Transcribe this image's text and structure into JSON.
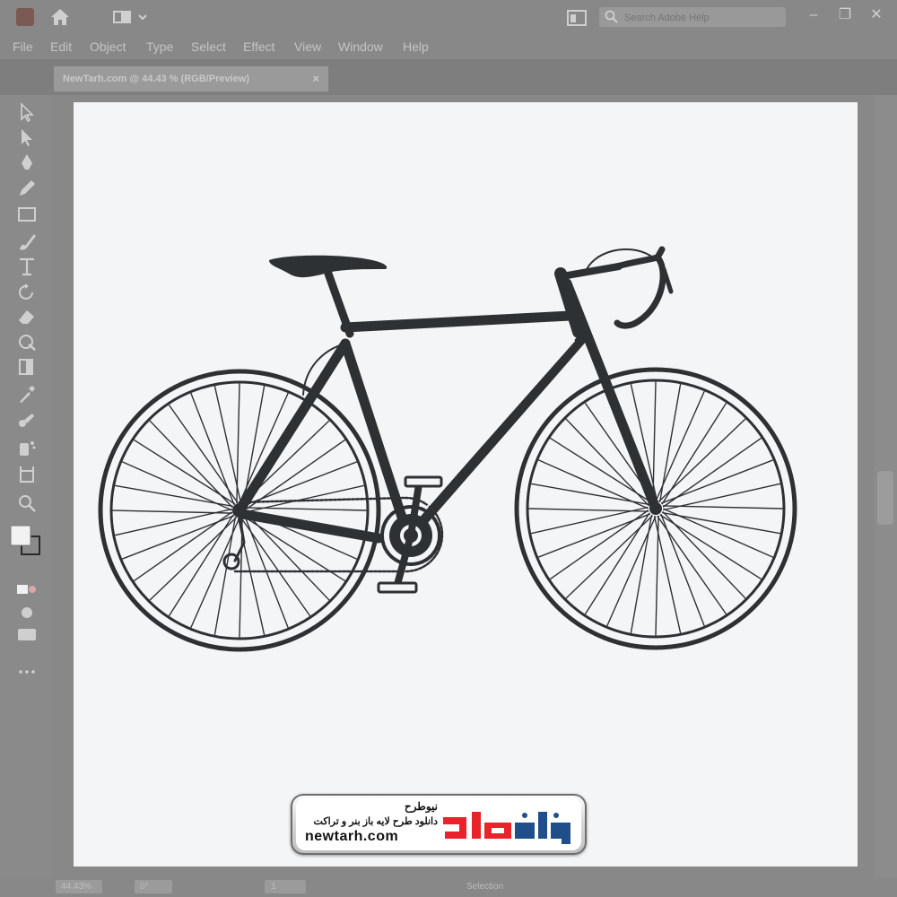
{
  "menu": [
    "File",
    "Edit",
    "Object",
    "Type",
    "Select",
    "Effect",
    "View",
    "Window",
    "Help"
  ],
  "search": {
    "placeholder": "Search Adobe Help"
  },
  "window_controls": {
    "minimize": "–",
    "restore": "❐",
    "close": "✕"
  },
  "document_tab": {
    "title": "NewTarh.com @ 44.43 % (RGB/Preview)",
    "close": "×"
  },
  "status": {
    "zoom": "44.43%",
    "rotation": "0°",
    "artboard": "1",
    "tool": "Selection"
  },
  "watermark": {
    "brand_fa": "نیوطرح",
    "tagline_fa": "دانلود طرح لایه باز بنر و تراکت",
    "url": "newtarh.com"
  },
  "colors": {
    "bike": "#2e3134",
    "artboard": "#f4f5f6",
    "chrome": "#888888",
    "brand_red": "#e8232a"
  },
  "icons": [
    "home-icon",
    "workspace-icon",
    "arrange-icon",
    "search-icon",
    "selection-tool-icon",
    "direct-selection-tool-icon",
    "pen-tool-icon",
    "pencil-tool-icon",
    "rectangle-tool-icon",
    "brush-tool-icon",
    "type-tool-icon",
    "rotate-tool-icon",
    "eraser-tool-icon",
    "warp-tool-icon",
    "shape-builder-icon",
    "eyedropper-icon",
    "blend-tool-icon",
    "symbol-sprayer-icon",
    "artboard-tool-icon",
    "zoom-tool-icon",
    "fill-stroke-icon",
    "drawing-mode-icon",
    "screen-mode-icon",
    "more-tools-icon"
  ]
}
